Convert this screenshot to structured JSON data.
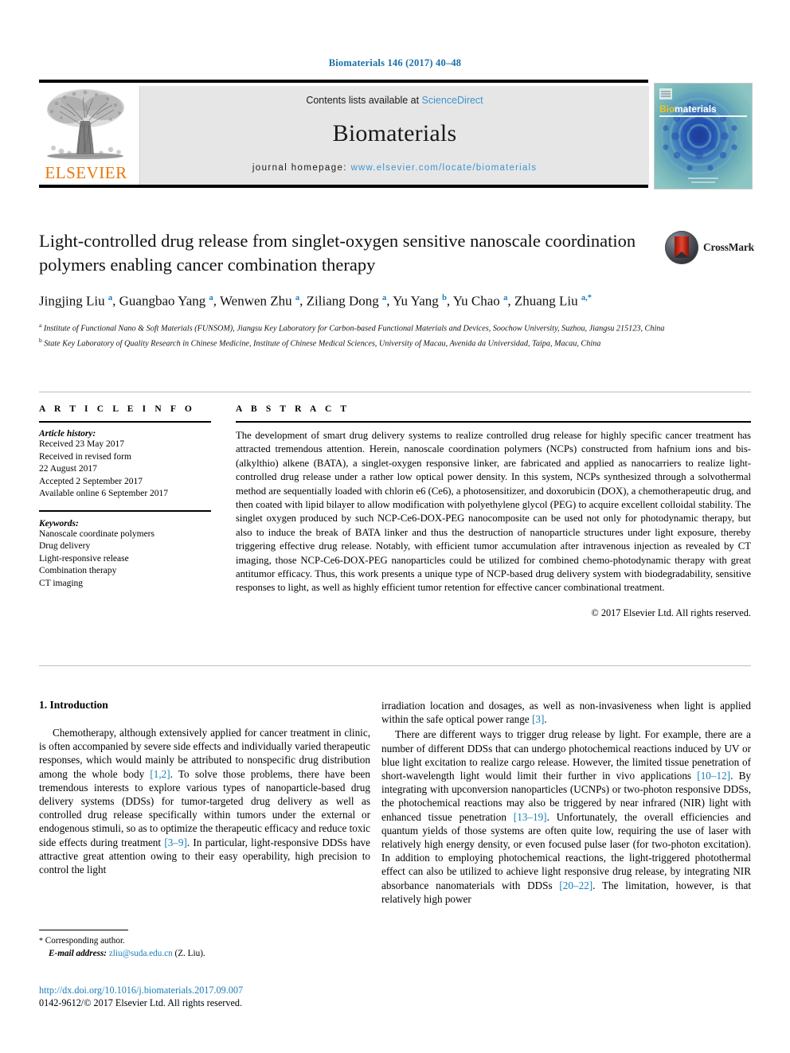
{
  "running_head": "Biomaterials 146 (2017) 40–48",
  "masthead": {
    "publisher": "ELSEVIER",
    "contents_prefix": "Contents lists available at ",
    "contents_link": "ScienceDirect",
    "journal_name": "Biomaterials",
    "homepage_prefix": "journal homepage: ",
    "homepage_url": "www.elsevier.com/locate/biomaterials",
    "cover_title_bio": "Bio",
    "cover_title_materials": "materials"
  },
  "title": "Light-controlled drug release from singlet-oxygen sensitive nanoscale coordination polymers enabling cancer combination therapy",
  "crossmark_label": "CrossMark",
  "authors_html": "Jingjing Liu <sup>a</sup>, Guangbao Yang <sup>a</sup>, Wenwen Zhu <sup>a</sup>, Ziliang Dong <sup>a</sup>, Yu Yang <sup>b</sup>, Yu Chao <sup>a</sup>, Zhuang Liu <sup>a,&#42;</sup>",
  "affiliations": [
    "Institute of Functional Nano & Soft Materials (FUNSOM), Jiangsu Key Laboratory for Carbon-based Functional Materials and Devices, Soochow University, Suzhou, Jiangsu 215123, China",
    "State Key Laboratory of Quality Research in Chinese Medicine, Institute of Chinese Medical Sciences, University of Macau, Avenida da Universidad, Taipa, Macau, China"
  ],
  "affiliation_marks": [
    "a",
    "b"
  ],
  "article_info": {
    "heading": "A R T I C L E   I N F O",
    "history_label": "Article history:",
    "history": [
      "Received 23 May 2017",
      "Received in revised form",
      "22 August 2017",
      "Accepted 2 September 2017",
      "Available online 6 September 2017"
    ],
    "keywords_label": "Keywords:",
    "keywords": [
      "Nanoscale coordinate polymers",
      "Drug delivery",
      "Light-responsive release",
      "Combination therapy",
      "CT imaging"
    ]
  },
  "abstract": {
    "heading": "A B S T R A C T",
    "text": "The development of smart drug delivery systems to realize controlled drug release for highly specific cancer treatment has attracted tremendous attention. Herein, nanoscale coordination polymers (NCPs) constructed from hafnium ions and bis-(alkylthio) alkene (BATA), a singlet-oxygen responsive linker, are fabricated and applied as nanocarriers to realize light-controlled drug release under a rather low optical power density. In this system, NCPs synthesized through a solvothermal method are sequentially loaded with chlorin e6 (Ce6), a photosensitizer, and doxorubicin (DOX), a chemotherapeutic drug, and then coated with lipid bilayer to allow modification with polyethylene glycol (PEG) to acquire excellent colloidal stability. The singlet oxygen produced by such NCP-Ce6-DOX-PEG nanocomposite can be used not only for photodynamic therapy, but also to induce the break of BATA linker and thus the destruction of nanoparticle structures under light exposure, thereby triggering effective drug release. Notably, with efficient tumor accumulation after intravenous injection as revealed by CT imaging, those NCP-Ce6-DOX-PEG nanoparticles could be utilized for combined chemo-photodynamic therapy with great antitumor efficacy. Thus, this work presents a unique type of NCP-based drug delivery system with biodegradability, sensitive responses to light, as well as highly efficient tumor retention for effective cancer combinational treatment.",
    "copyright": "© 2017 Elsevier Ltd. All rights reserved."
  },
  "introduction": {
    "section_title": "1. Introduction",
    "left_paragraph_html": "Chemotherapy, although extensively applied for cancer treatment in clinic, is often accompanied by severe side effects and individually varied therapeutic responses, which would mainly be attributed to nonspecific drug distribution among the whole body <span class=\"ref\">[1,2]</span>. To solve those problems, there have been tremendous interests to explore various types of nanoparticle-based drug delivery systems (DDSs) for tumor-targeted drug delivery as well as controlled drug release specifically within tumors under the external or endogenous stimuli, so as to optimize the therapeutic efficacy and reduce toxic side effects during treatment <span class=\"ref\">[3–9]</span>. In particular, light-responsive DDSs have attractive great attention owing to their easy operability, high precision to control the light",
    "right_paragraph_1_html": "irradiation location and dosages, as well as non-invasiveness when light is applied within the safe optical power range <span class=\"ref\">[3]</span>.",
    "right_paragraph_2_html": "There are different ways to trigger drug release by light. For example, there are a number of different DDSs that can undergo photochemical reactions induced by UV or blue light excitation to realize cargo release. However, the limited tissue penetration of short-wavelength light would limit their further in vivo applications <span class=\"ref\">[10–12]</span>. By integrating with upconversion nanoparticles (UCNPs) or two-photon responsive DDSs, the photochemical reactions may also be triggered by near infrared (NIR) light with enhanced tissue penetration <span class=\"ref\">[13–19]</span>. Unfortunately, the overall efficiencies and quantum yields of those systems are often quite low, requiring the use of laser with relatively high energy density, or even focused pulse laser (for two-photon excitation). In addition to employing photochemical reactions, the light-triggered photothermal effect can also be utilized to achieve light responsive drug release, by integrating NIR absorbance nanomaterials with DDSs <span class=\"ref\">[20–22]</span>. The limitation, however, is that relatively high power"
  },
  "footnote": {
    "corresponding_marker": "*",
    "corresponding_label": "Corresponding author.",
    "email_label": "E-mail address:",
    "email": "zliu@suda.edu.cn",
    "email_suffix": "(Z. Liu)."
  },
  "doi": "http://dx.doi.org/10.1016/j.biomaterials.2017.09.007",
  "issn_line": "0142-9612/© 2017 Elsevier Ltd. All rights reserved.",
  "colors": {
    "link_blue": "#1a7eb8",
    "sciencedirect_blue": "#3d94d1",
    "elsevier_orange": "#e8770d",
    "cover_teal": "#5fa8ad",
    "crossmark_red": "#c9281a"
  }
}
